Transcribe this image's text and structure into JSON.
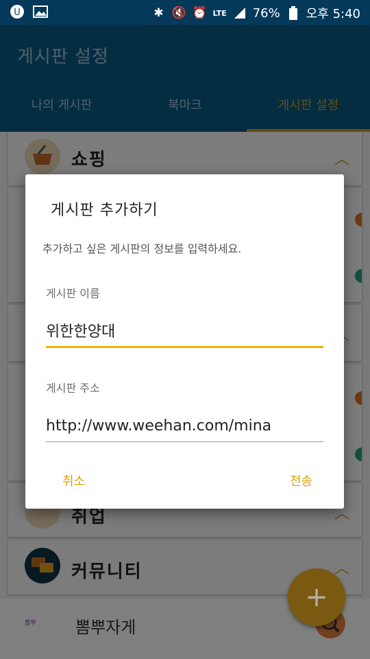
{
  "status_bar": {
    "battery": "76%",
    "time": "오후 5:40",
    "network": "LTE"
  },
  "app": {
    "title": "게시판 설정"
  },
  "tabs": [
    {
      "label": "나의 게시판"
    },
    {
      "label": "북마크"
    },
    {
      "label": "게시판 설정"
    }
  ],
  "categories": [
    {
      "title": "쇼핑"
    },
    {
      "title": "취업"
    },
    {
      "title": "커뮤니티"
    }
  ],
  "list_item": {
    "label": "뽐뿌자게"
  },
  "dialog": {
    "title": "게시판 추가하기",
    "message": "추가하고 싶은 게시판의 정보를 입력하세요.",
    "name_label": "게시판 이름",
    "name_value": "위한한양대",
    "url_label": "게시판 주소",
    "url_value": "http://www.weehan.com/mina",
    "cancel_label": "취소",
    "submit_label": "전송"
  },
  "colors": {
    "accent": "#f2b200",
    "primary": "#0a5b84"
  }
}
